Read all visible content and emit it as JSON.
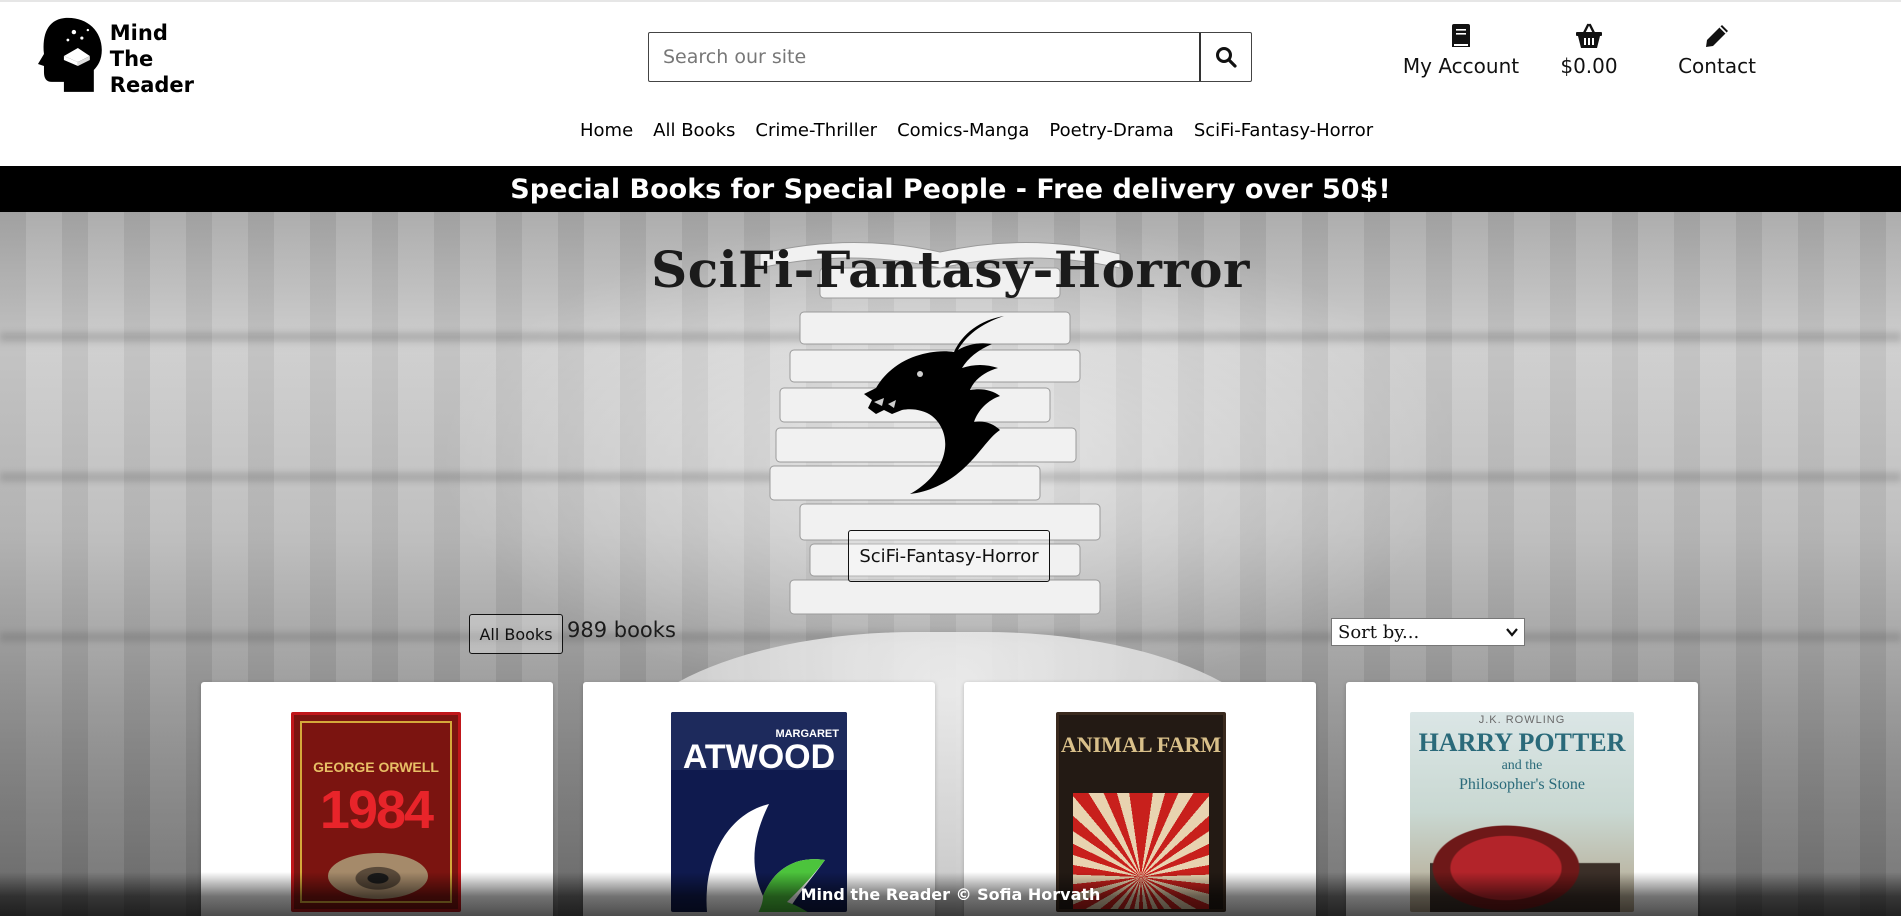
{
  "brand": {
    "line1": "Mind",
    "line2": "The",
    "line3": "Reader",
    "logo_icon": "head-book-icon"
  },
  "search": {
    "placeholder": "Search our site",
    "icon": "search-icon"
  },
  "account": {
    "my_account": "My Account",
    "cart_total": "$0.00",
    "contact": "Contact"
  },
  "nav": [
    "Home",
    "All Books",
    "Crime-Thriller",
    "Comics-Manga",
    "Poetry-Drama",
    "SciFi-Fantasy-Horror"
  ],
  "banner": "Special Books for Special People - Free delivery over 50$!",
  "category": {
    "title": "SciFi-Fantasy-Horror",
    "badge": "SciFi-Fantasy-Horror",
    "icon": "dragon-icon"
  },
  "toolbar": {
    "all_books": "All Books",
    "count": "989 books",
    "sort_placeholder": "Sort by..."
  },
  "books": [
    {
      "cover_author": "GEORGE ORWELL",
      "cover_title": "1984"
    },
    {
      "cover_author": "MARGARET",
      "cover_title": "ATWOOD"
    },
    {
      "cover_title": "ANIMAL FARM"
    },
    {
      "cover_author": "J.K. ROWLING",
      "cover_title": "HARRY POTTER",
      "cover_title_2": "and the",
      "cover_title_3": "Philosopher's Stone"
    }
  ],
  "footer": "Mind the Reader © Sofia Horvath",
  "colors": {
    "banner_bg": "#000000",
    "header_bg": "#ffffff"
  }
}
